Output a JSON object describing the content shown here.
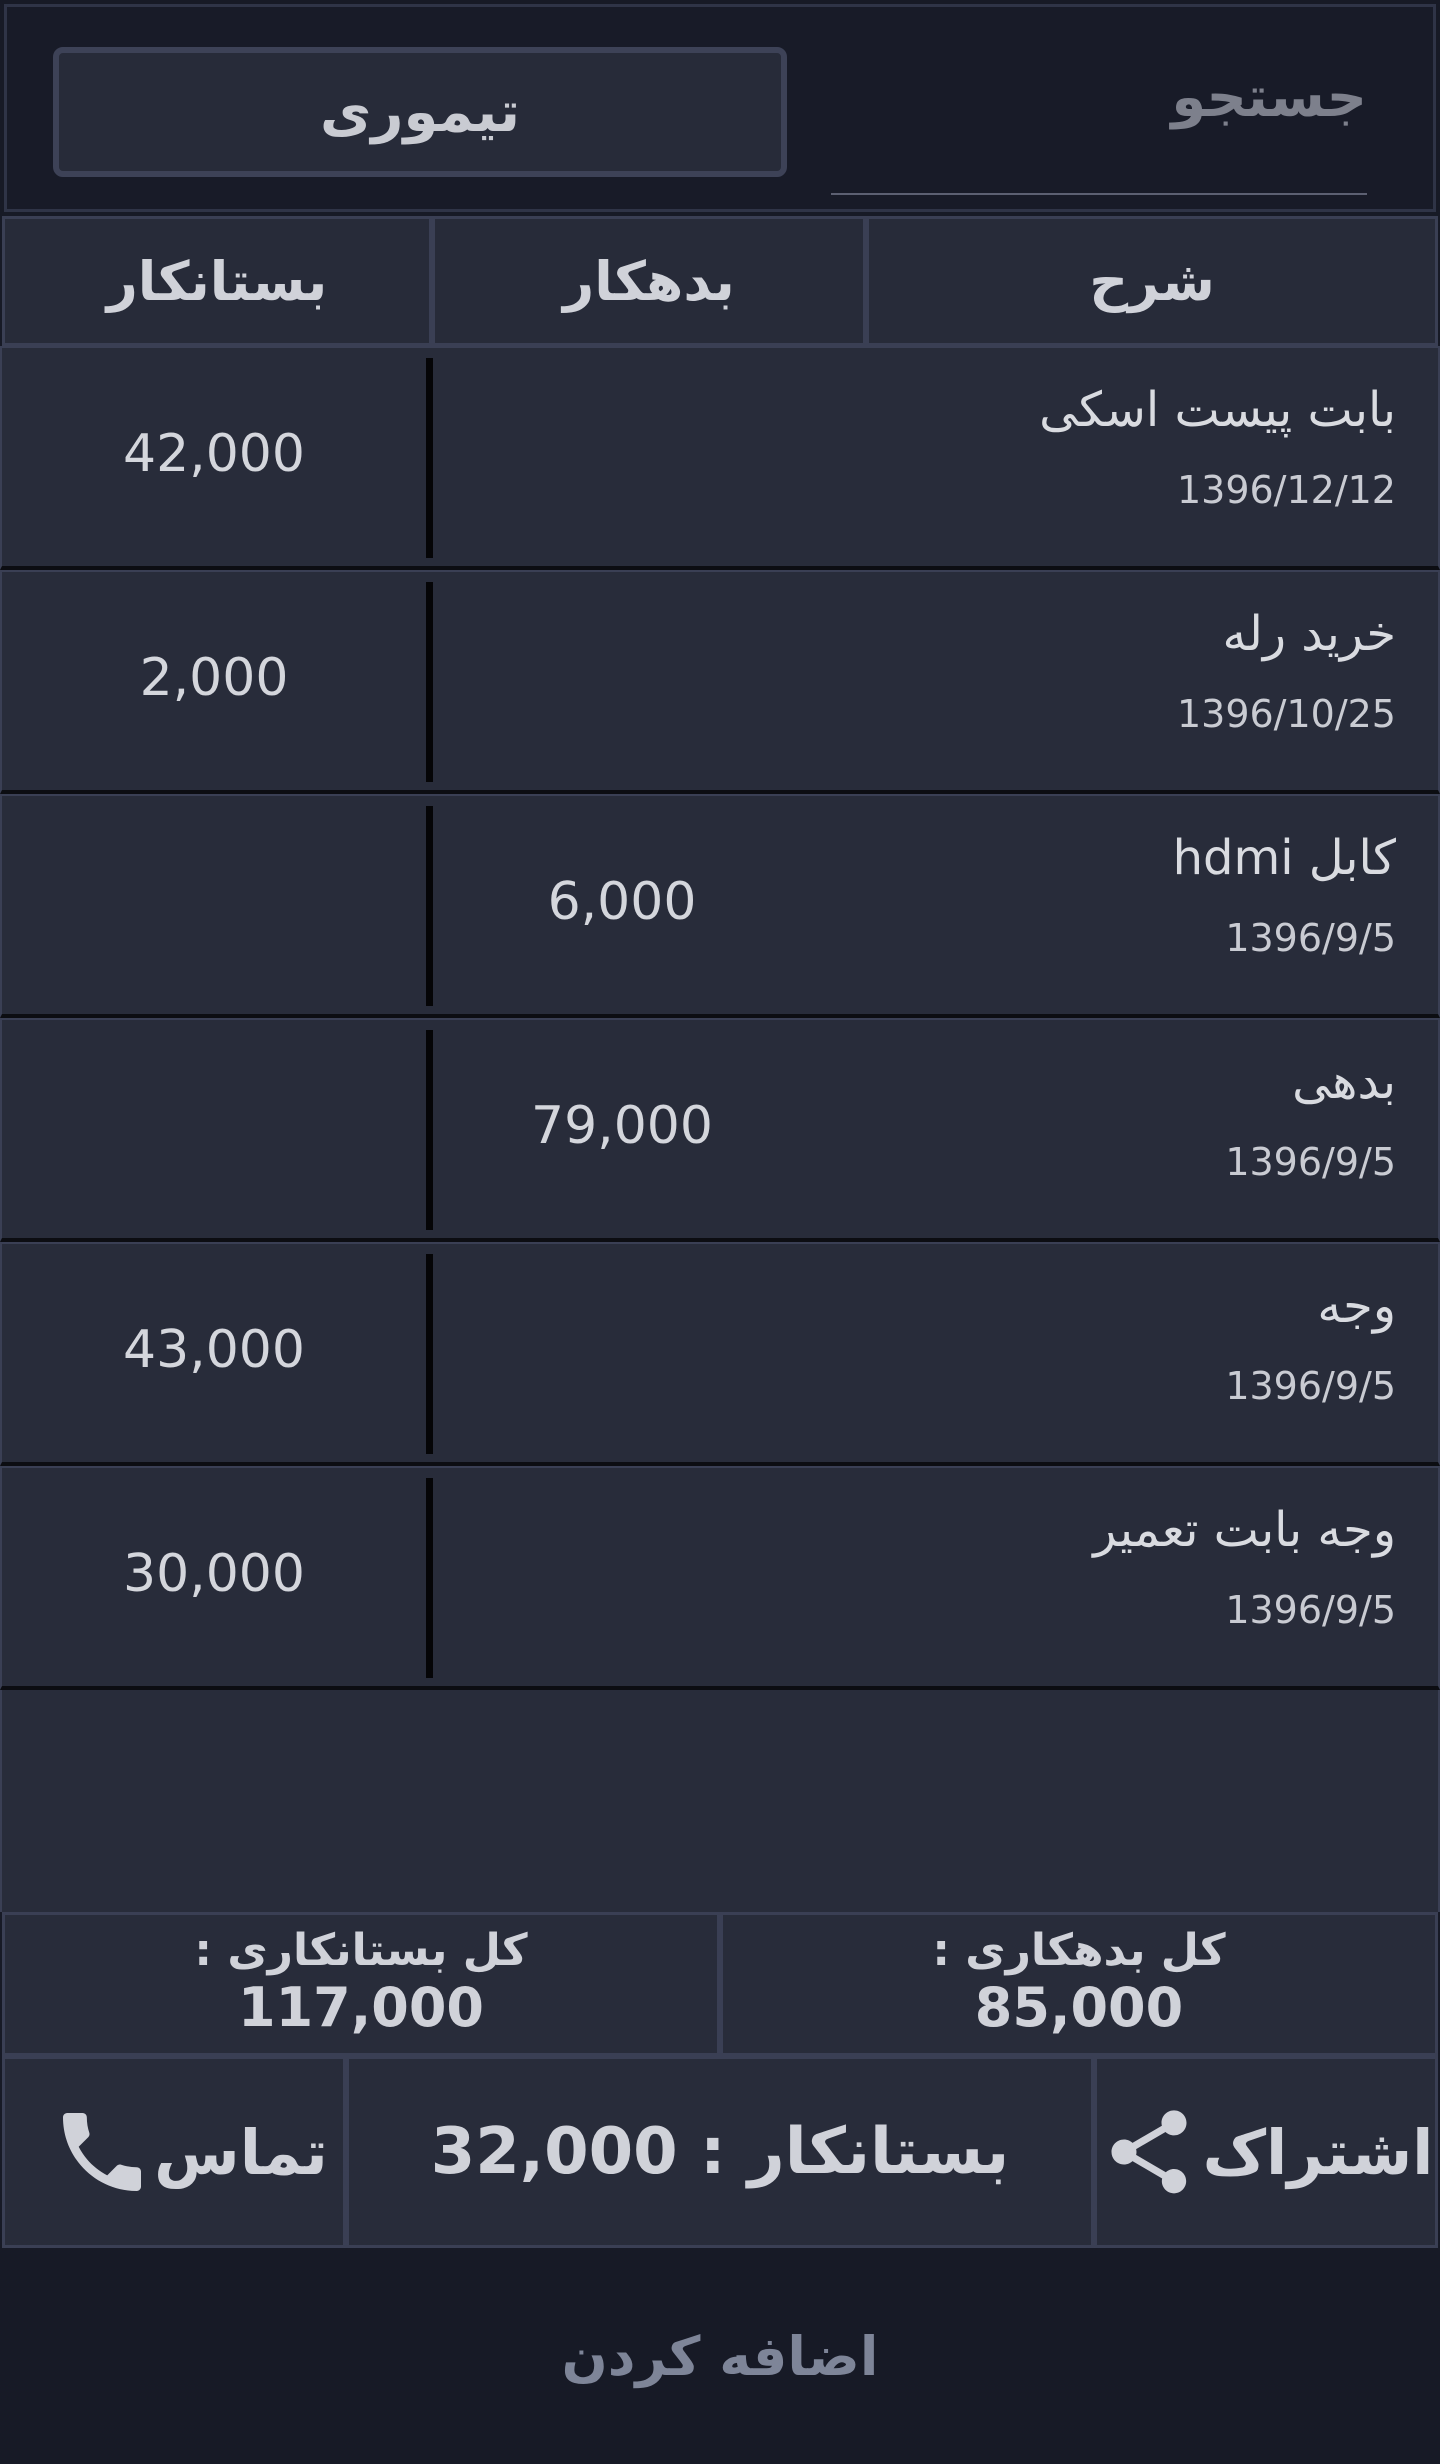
{
  "header": {
    "search_placeholder": "جستجو",
    "customer_name": "تیموری"
  },
  "columns": {
    "description": "شرح",
    "debit": "بدهکار",
    "credit": "بستانکار"
  },
  "rows": [
    {
      "description": "بابت پیست اسکی",
      "date": "1396/12/12",
      "debit": "",
      "credit": "42,000"
    },
    {
      "description": "خرید رله",
      "date": "1396/10/25",
      "debit": "",
      "credit": "2,000"
    },
    {
      "description": "کابل hdmi",
      "date": "1396/9/5",
      "debit": "6,000",
      "credit": ""
    },
    {
      "description": "بدهی",
      "date": "1396/9/5",
      "debit": "79,000",
      "credit": ""
    },
    {
      "description": "وجه",
      "date": "1396/9/5",
      "debit": "",
      "credit": "43,000"
    },
    {
      "description": "وجه بابت تعمیر",
      "date": "1396/9/5",
      "debit": "",
      "credit": "30,000"
    }
  ],
  "totals": {
    "debit_label": "کل بدهکاری :",
    "debit_value": "85,000",
    "credit_label": "کل بستانکاری :",
    "credit_value": "117,000"
  },
  "actions": {
    "share_label": "اشتراک",
    "balance_label": "بستانکار : 32,000",
    "call_label": "تماس"
  },
  "add_button_label": "اضافه کردن",
  "icons": {
    "share": "share-icon",
    "phone": "phone-icon"
  },
  "colors": {
    "background": "#171a26",
    "panel": "#282c3a",
    "border": "#3a3f54"
  }
}
